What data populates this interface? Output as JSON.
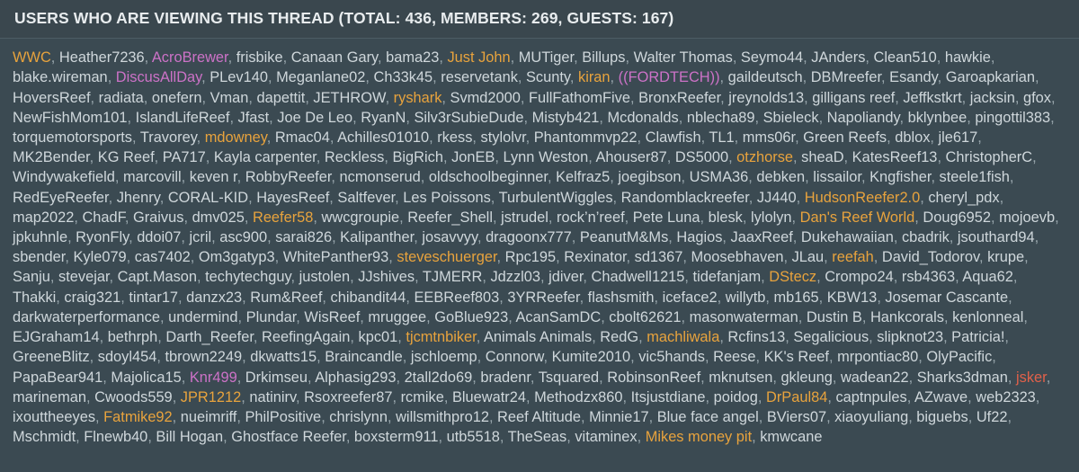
{
  "header": {
    "title": "USERS WHO ARE VIEWING THIS THREAD (TOTAL: 436, MEMBERS: 269, GUESTS: 167)",
    "total": 436,
    "members": 269,
    "guests": 167
  },
  "colors": {
    "panel_background": "#3b4a52",
    "header_background": "#3a474e",
    "header_text": "#e8ecee",
    "default_user": "#cfd7db",
    "orange_user": "#e8a33d",
    "pink_user": "#cc72c7",
    "red_user": "#e0614a",
    "separator": "#9aa8ae"
  },
  "separator": ",",
  "users": [
    {
      "name": "WWC",
      "color": "orange"
    },
    {
      "name": "Heather7236",
      "color": "default"
    },
    {
      "name": "AcroBrewer",
      "color": "pink"
    },
    {
      "name": "frisbike",
      "color": "default"
    },
    {
      "name": "Canaan Gary",
      "color": "default"
    },
    {
      "name": "bama23",
      "color": "default"
    },
    {
      "name": "Just John",
      "color": "orange"
    },
    {
      "name": "MUTiger",
      "color": "default"
    },
    {
      "name": "Billups",
      "color": "default"
    },
    {
      "name": "Walter Thomas",
      "color": "default"
    },
    {
      "name": "Seymo44",
      "color": "default"
    },
    {
      "name": "JAnders",
      "color": "default"
    },
    {
      "name": "Clean510",
      "color": "default"
    },
    {
      "name": "hawkie",
      "color": "default"
    },
    {
      "name": "blake.wireman",
      "color": "default"
    },
    {
      "name": "DiscusAllDay",
      "color": "pink"
    },
    {
      "name": "PLev140",
      "color": "default"
    },
    {
      "name": "Meganlane02",
      "color": "default"
    },
    {
      "name": "Ch33k45",
      "color": "default"
    },
    {
      "name": "reservetank",
      "color": "default"
    },
    {
      "name": "Scunty",
      "color": "default"
    },
    {
      "name": "kiran",
      "color": "orange"
    },
    {
      "name": "((FORDTECH))",
      "color": "pink"
    },
    {
      "name": "gaildeutsch",
      "color": "default"
    },
    {
      "name": "DBMreefer",
      "color": "default"
    },
    {
      "name": "Esandy",
      "color": "default"
    },
    {
      "name": "Garoapkarian",
      "color": "default"
    },
    {
      "name": "HoversReef",
      "color": "default"
    },
    {
      "name": "radiata",
      "color": "default"
    },
    {
      "name": "onefern",
      "color": "default"
    },
    {
      "name": "Vman",
      "color": "default"
    },
    {
      "name": "dapettit",
      "color": "default"
    },
    {
      "name": "JETHROW",
      "color": "default"
    },
    {
      "name": "ryshark",
      "color": "orange"
    },
    {
      "name": "Svmd2000",
      "color": "default"
    },
    {
      "name": "FullFathomFive",
      "color": "default"
    },
    {
      "name": "BronxReefer",
      "color": "default"
    },
    {
      "name": "jreynolds13",
      "color": "default"
    },
    {
      "name": "gilligans reef",
      "color": "default"
    },
    {
      "name": "Jeffkstkrt",
      "color": "default"
    },
    {
      "name": "jacksin",
      "color": "default"
    },
    {
      "name": "gfox",
      "color": "default"
    },
    {
      "name": "NewFishMom101",
      "color": "default"
    },
    {
      "name": "IslandLifeReef",
      "color": "default"
    },
    {
      "name": "Jfast",
      "color": "default"
    },
    {
      "name": "Joe De Leo",
      "color": "default"
    },
    {
      "name": "RyanN",
      "color": "default"
    },
    {
      "name": "Silv3rSubieDude",
      "color": "default"
    },
    {
      "name": "Mistyb421",
      "color": "default"
    },
    {
      "name": "Mcdonalds",
      "color": "default"
    },
    {
      "name": "nblecha89",
      "color": "default"
    },
    {
      "name": "Sbieleck",
      "color": "default"
    },
    {
      "name": "Napoliandy",
      "color": "default"
    },
    {
      "name": "bklynbee",
      "color": "default"
    },
    {
      "name": "pingottil383",
      "color": "default"
    },
    {
      "name": "torquemotorsports",
      "color": "default"
    },
    {
      "name": "Travorey",
      "color": "default"
    },
    {
      "name": "mdowney",
      "color": "orange"
    },
    {
      "name": "Rmac04",
      "color": "default"
    },
    {
      "name": "Achilles01010",
      "color": "default"
    },
    {
      "name": "rkess",
      "color": "default"
    },
    {
      "name": "stylolvr",
      "color": "default"
    },
    {
      "name": "Phantommvp22",
      "color": "default"
    },
    {
      "name": "Clawfish",
      "color": "default"
    },
    {
      "name": "TL1",
      "color": "default"
    },
    {
      "name": "mms06r",
      "color": "default"
    },
    {
      "name": "Green Reefs",
      "color": "default"
    },
    {
      "name": "dblox",
      "color": "default"
    },
    {
      "name": "jle617",
      "color": "default"
    },
    {
      "name": "MK2Bender",
      "color": "default"
    },
    {
      "name": "KG Reef",
      "color": "default"
    },
    {
      "name": "PA717",
      "color": "default"
    },
    {
      "name": "Kayla carpenter",
      "color": "default"
    },
    {
      "name": "Reckless",
      "color": "default"
    },
    {
      "name": "BigRich",
      "color": "default"
    },
    {
      "name": "JonEB",
      "color": "default"
    },
    {
      "name": "Lynn Weston",
      "color": "default"
    },
    {
      "name": "Ahouser87",
      "color": "default"
    },
    {
      "name": "DS5000",
      "color": "default"
    },
    {
      "name": "otzhorse",
      "color": "orange"
    },
    {
      "name": "sheaD",
      "color": "default"
    },
    {
      "name": "KatesReef13",
      "color": "default"
    },
    {
      "name": "ChristopherC",
      "color": "default"
    },
    {
      "name": "Windywakefield",
      "color": "default"
    },
    {
      "name": "marcovill",
      "color": "default"
    },
    {
      "name": "keven r",
      "color": "default"
    },
    {
      "name": "RobbyReefer",
      "color": "default"
    },
    {
      "name": "ncmonserud",
      "color": "default"
    },
    {
      "name": "oldschoolbeginner",
      "color": "default"
    },
    {
      "name": "Kelfraz5",
      "color": "default"
    },
    {
      "name": "joegibson",
      "color": "default"
    },
    {
      "name": "USMA36",
      "color": "default"
    },
    {
      "name": "debken",
      "color": "default"
    },
    {
      "name": "lissailor",
      "color": "default"
    },
    {
      "name": "Kngfisher",
      "color": "default"
    },
    {
      "name": "steele1fish",
      "color": "default"
    },
    {
      "name": "RedEyeReefer",
      "color": "default"
    },
    {
      "name": "Jhenry",
      "color": "default"
    },
    {
      "name": "CORAL-KID",
      "color": "default"
    },
    {
      "name": "HayesReef",
      "color": "default"
    },
    {
      "name": "Saltfever",
      "color": "default"
    },
    {
      "name": "Les Poissons",
      "color": "default"
    },
    {
      "name": "TurbulentWiggles",
      "color": "default"
    },
    {
      "name": "Randomblackreefer",
      "color": "default"
    },
    {
      "name": "JJ440",
      "color": "default"
    },
    {
      "name": "HudsonReefer2.0",
      "color": "orange"
    },
    {
      "name": "cheryl_pdx",
      "color": "default"
    },
    {
      "name": "map2022",
      "color": "default"
    },
    {
      "name": "ChadF",
      "color": "default"
    },
    {
      "name": "Graivus",
      "color": "default"
    },
    {
      "name": "dmv025",
      "color": "default"
    },
    {
      "name": "Reefer58",
      "color": "orange"
    },
    {
      "name": "wwcgroupie",
      "color": "default"
    },
    {
      "name": "Reefer_Shell",
      "color": "default"
    },
    {
      "name": "jstrudel",
      "color": "default"
    },
    {
      "name": "rock’n’reef",
      "color": "default"
    },
    {
      "name": "Pete Luna",
      "color": "default"
    },
    {
      "name": "blesk",
      "color": "default"
    },
    {
      "name": "lylolyn",
      "color": "default"
    },
    {
      "name": "Dan's Reef World",
      "color": "orange"
    },
    {
      "name": "Doug6952",
      "color": "default"
    },
    {
      "name": "mojoevb",
      "color": "default"
    },
    {
      "name": "jpkuhnle",
      "color": "default"
    },
    {
      "name": "RyonFly",
      "color": "default"
    },
    {
      "name": "ddoi07",
      "color": "default"
    },
    {
      "name": "jcril",
      "color": "default"
    },
    {
      "name": "asc900",
      "color": "default"
    },
    {
      "name": "sarai826",
      "color": "default"
    },
    {
      "name": "Kalipanther",
      "color": "default"
    },
    {
      "name": "josavvyy",
      "color": "default"
    },
    {
      "name": "dragoonx777",
      "color": "default"
    },
    {
      "name": "PeanutM&Ms",
      "color": "default"
    },
    {
      "name": "Hagios",
      "color": "default"
    },
    {
      "name": "JaaxReef",
      "color": "default"
    },
    {
      "name": "Dukehawaiian",
      "color": "default"
    },
    {
      "name": "cbadrik",
      "color": "default"
    },
    {
      "name": "jsouthard94",
      "color": "default"
    },
    {
      "name": "sbender",
      "color": "default"
    },
    {
      "name": "Kyle079",
      "color": "default"
    },
    {
      "name": "cas7402",
      "color": "default"
    },
    {
      "name": "Om3gatyp3",
      "color": "default"
    },
    {
      "name": "WhitePanther93",
      "color": "default"
    },
    {
      "name": "steveschuerger",
      "color": "orange"
    },
    {
      "name": "Rpc195",
      "color": "default"
    },
    {
      "name": "Rexinator",
      "color": "default"
    },
    {
      "name": "sd1367",
      "color": "default"
    },
    {
      "name": "Moosebhaven",
      "color": "default"
    },
    {
      "name": "JLau",
      "color": "default"
    },
    {
      "name": "reefah",
      "color": "orange"
    },
    {
      "name": "David_Todorov",
      "color": "default"
    },
    {
      "name": "krupe",
      "color": "default"
    },
    {
      "name": "Sanju",
      "color": "default"
    },
    {
      "name": "stevejar",
      "color": "default"
    },
    {
      "name": "Capt.Mason",
      "color": "default"
    },
    {
      "name": "techytechguy",
      "color": "default"
    },
    {
      "name": "justolen",
      "color": "default"
    },
    {
      "name": "JJshives",
      "color": "default"
    },
    {
      "name": "TJMERR",
      "color": "default"
    },
    {
      "name": "Jdzzl03",
      "color": "default"
    },
    {
      "name": "jdiver",
      "color": "default"
    },
    {
      "name": "Chadwell1215",
      "color": "default"
    },
    {
      "name": "tidefanjam",
      "color": "default"
    },
    {
      "name": "DStecz",
      "color": "orange"
    },
    {
      "name": "Crompo24",
      "color": "default"
    },
    {
      "name": "rsb4363",
      "color": "default"
    },
    {
      "name": "Aqua62",
      "color": "default"
    },
    {
      "name": "Thakki",
      "color": "default"
    },
    {
      "name": "craig321",
      "color": "default"
    },
    {
      "name": "tintar17",
      "color": "default"
    },
    {
      "name": "danzx23",
      "color": "default"
    },
    {
      "name": "Rum&Reef",
      "color": "default"
    },
    {
      "name": "chibandit44",
      "color": "default"
    },
    {
      "name": "EEBReef803",
      "color": "default"
    },
    {
      "name": "3YRReefer",
      "color": "default"
    },
    {
      "name": "flashsmith",
      "color": "default"
    },
    {
      "name": "iceface2",
      "color": "default"
    },
    {
      "name": "willytb",
      "color": "default"
    },
    {
      "name": "mb165",
      "color": "default"
    },
    {
      "name": "KBW13",
      "color": "default"
    },
    {
      "name": "Josemar Cascante",
      "color": "default"
    },
    {
      "name": "darkwaterperformance",
      "color": "default"
    },
    {
      "name": "undermind",
      "color": "default"
    },
    {
      "name": "Plundar",
      "color": "default"
    },
    {
      "name": "WisReef",
      "color": "default"
    },
    {
      "name": "mruggee",
      "color": "default"
    },
    {
      "name": "GoBlue923",
      "color": "default"
    },
    {
      "name": "AcanSamDC",
      "color": "default"
    },
    {
      "name": "cbolt62621",
      "color": "default"
    },
    {
      "name": "masonwaterman",
      "color": "default"
    },
    {
      "name": "Dustin B",
      "color": "default"
    },
    {
      "name": "Hankcorals",
      "color": "default"
    },
    {
      "name": "kenlonneal",
      "color": "default"
    },
    {
      "name": "EJGraham14",
      "color": "default"
    },
    {
      "name": "bethrph",
      "color": "default"
    },
    {
      "name": "Darth_Reefer",
      "color": "default"
    },
    {
      "name": "ReefingAgain",
      "color": "default"
    },
    {
      "name": "kpc01",
      "color": "default"
    },
    {
      "name": "tjcmtnbiker",
      "color": "orange"
    },
    {
      "name": "Animals Animals",
      "color": "default"
    },
    {
      "name": "RedG",
      "color": "default"
    },
    {
      "name": "machliwala",
      "color": "orange"
    },
    {
      "name": "Rcfins13",
      "color": "default"
    },
    {
      "name": "Segalicious",
      "color": "default"
    },
    {
      "name": "slipknot23",
      "color": "default"
    },
    {
      "name": "Patricia!",
      "color": "default"
    },
    {
      "name": "GreeneBlitz",
      "color": "default"
    },
    {
      "name": "sdoyl454",
      "color": "default"
    },
    {
      "name": "tbrown2249",
      "color": "default"
    },
    {
      "name": "dkwatts15",
      "color": "default"
    },
    {
      "name": "Braincandle",
      "color": "default"
    },
    {
      "name": "jschloemp",
      "color": "default"
    },
    {
      "name": "Connorw",
      "color": "default"
    },
    {
      "name": "Kumite2010",
      "color": "default"
    },
    {
      "name": "vic5hands",
      "color": "default"
    },
    {
      "name": "Reese",
      "color": "default"
    },
    {
      "name": "KK's Reef",
      "color": "default"
    },
    {
      "name": "mrpontiac80",
      "color": "default"
    },
    {
      "name": "OlyPacific",
      "color": "default"
    },
    {
      "name": "PapaBear941",
      "color": "default"
    },
    {
      "name": "Majolica15",
      "color": "default"
    },
    {
      "name": "Knr499",
      "color": "pink"
    },
    {
      "name": "Drkimseu",
      "color": "default"
    },
    {
      "name": "Alphasig293",
      "color": "default"
    },
    {
      "name": "2tall2do69",
      "color": "default"
    },
    {
      "name": "bradenr",
      "color": "default"
    },
    {
      "name": "Tsquared",
      "color": "default"
    },
    {
      "name": "RobinsonReef",
      "color": "default"
    },
    {
      "name": "mknutsen",
      "color": "default"
    },
    {
      "name": "gkleung",
      "color": "default"
    },
    {
      "name": "wadean22",
      "color": "default"
    },
    {
      "name": "Sharks3dman",
      "color": "default"
    },
    {
      "name": "jsker",
      "color": "red"
    },
    {
      "name": "marineman",
      "color": "default"
    },
    {
      "name": "Cwoods559",
      "color": "default"
    },
    {
      "name": "JPR1212",
      "color": "orange"
    },
    {
      "name": "natinirv",
      "color": "default"
    },
    {
      "name": "Rsoxreefer87",
      "color": "default"
    },
    {
      "name": "rcmike",
      "color": "default"
    },
    {
      "name": "Bluewatr24",
      "color": "default"
    },
    {
      "name": "Methodzx860",
      "color": "default"
    },
    {
      "name": "Itsjustdiane",
      "color": "default"
    },
    {
      "name": "poidog",
      "color": "default"
    },
    {
      "name": "DrPaul84",
      "color": "orange"
    },
    {
      "name": "captnpules",
      "color": "default"
    },
    {
      "name": "AZwave",
      "color": "default"
    },
    {
      "name": "web2323",
      "color": "default"
    },
    {
      "name": "ixouttheeyes",
      "color": "default"
    },
    {
      "name": "Fatmike92",
      "color": "orange"
    },
    {
      "name": "nueimriff",
      "color": "default"
    },
    {
      "name": "PhilPositive",
      "color": "default"
    },
    {
      "name": "chrislynn",
      "color": "default"
    },
    {
      "name": "willsmithpro12",
      "color": "default"
    },
    {
      "name": "Reef Altitude",
      "color": "default"
    },
    {
      "name": "Minnie17",
      "color": "default"
    },
    {
      "name": "Blue face angel",
      "color": "default"
    },
    {
      "name": "BViers07",
      "color": "default"
    },
    {
      "name": "xiaoyuliang",
      "color": "default"
    },
    {
      "name": "biguebs",
      "color": "default"
    },
    {
      "name": "Uf22",
      "color": "default"
    },
    {
      "name": "Mschmidt",
      "color": "default"
    },
    {
      "name": "Flnewb40",
      "color": "default"
    },
    {
      "name": "Bill Hogan",
      "color": "default"
    },
    {
      "name": "Ghostface Reefer",
      "color": "default"
    },
    {
      "name": "boxsterm911",
      "color": "default"
    },
    {
      "name": "utb5518",
      "color": "default"
    },
    {
      "name": "TheSeas",
      "color": "default"
    },
    {
      "name": "vitaminex",
      "color": "default"
    },
    {
      "name": "Mikes money pit",
      "color": "orange"
    },
    {
      "name": "kmwcane",
      "color": "default"
    }
  ]
}
